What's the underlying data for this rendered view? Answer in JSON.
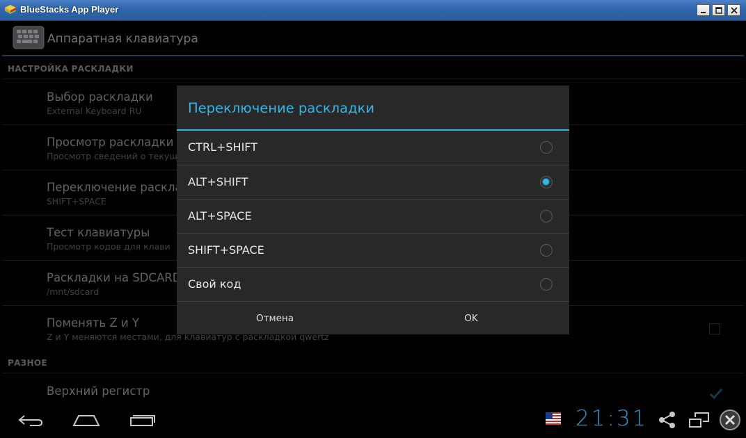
{
  "window": {
    "title": "BlueStacks App Player"
  },
  "app": {
    "title": "Аппаратная клавиатура",
    "sections": [
      {
        "label": "НАСТРОЙКА РАСКЛАДКИ"
      },
      {
        "label": "РАЗНОЕ"
      }
    ],
    "prefs": [
      {
        "title": "Выбор раскладки",
        "summary": "External Keyboard RU"
      },
      {
        "title": "Просмотр раскладки",
        "summary": "Просмотр сведений о текущ"
      },
      {
        "title": "Переключение раскла",
        "summary": "SHIFT+SPACE"
      },
      {
        "title": "Тест клавиатуры",
        "summary": "Просмотр кодов для клави"
      },
      {
        "title": "Раскладки на SDCARD",
        "summary": "/mnt/sdcard"
      },
      {
        "title": "Поменять Z и Y",
        "summary": "Z и Y меняются местами, для клавиатур с раскладкой qwertz"
      },
      {
        "title": "Верхний регистр",
        "summary": ""
      }
    ]
  },
  "dialog": {
    "title": "Переключение раскладки",
    "options": [
      {
        "label": "CTRL+SHIFT",
        "selected": false
      },
      {
        "label": "ALT+SHIFT",
        "selected": true
      },
      {
        "label": "ALT+SPACE",
        "selected": false
      },
      {
        "label": "SHIFT+SPACE",
        "selected": false
      },
      {
        "label": "Свой код",
        "selected": false
      }
    ],
    "cancel_label": "Отмена",
    "ok_label": "OK"
  },
  "navbar": {
    "clock": "21:31"
  },
  "colors": {
    "accent": "#33b5e5",
    "titlebar": "#2f64a8"
  },
  "icons": [
    "bluestacks-logo-icon",
    "minimize-icon",
    "maximize-icon",
    "close-icon",
    "keyboard-icon",
    "back-icon",
    "home-icon",
    "recent-apps-icon",
    "us-flag-icon",
    "share-icon",
    "window-icon",
    "close-circle-icon",
    "checkmark-icon"
  ]
}
